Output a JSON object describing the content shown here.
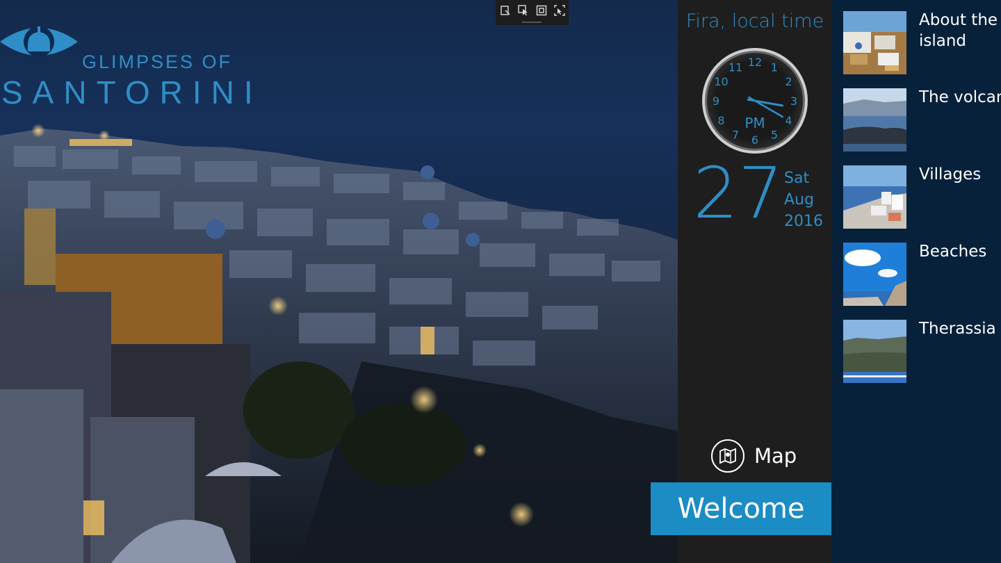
{
  "brand": {
    "line1": "GLIMPSES OF",
    "line2": "SANTORINI",
    "logo_icon": "eye-dome-icon",
    "color": "#2f8ec7"
  },
  "toolbar": {
    "items": [
      "select-element-icon",
      "pointer-icon",
      "frame-icon",
      "inspect-icon"
    ]
  },
  "clock_panel": {
    "title": "Fira, local time",
    "clock_numbers": [
      "12",
      "1",
      "2",
      "3",
      "4",
      "5",
      "6",
      "7",
      "8",
      "9",
      "10",
      "11"
    ],
    "ampm": "PM",
    "time": {
      "hour": 3,
      "minute": 20
    },
    "day": "27",
    "weekday": "Sat",
    "month": "Aug",
    "year": "2016"
  },
  "map_button": {
    "label": "Map",
    "icon": "map-icon"
  },
  "welcome_button": {
    "label": "Welcome",
    "color": "#1b8cc4"
  },
  "menu": {
    "items": [
      {
        "label": "About the island"
      },
      {
        "label": "The volcano"
      },
      {
        "label": "Villages"
      },
      {
        "label": "Beaches"
      },
      {
        "label": "Therassia"
      }
    ]
  }
}
